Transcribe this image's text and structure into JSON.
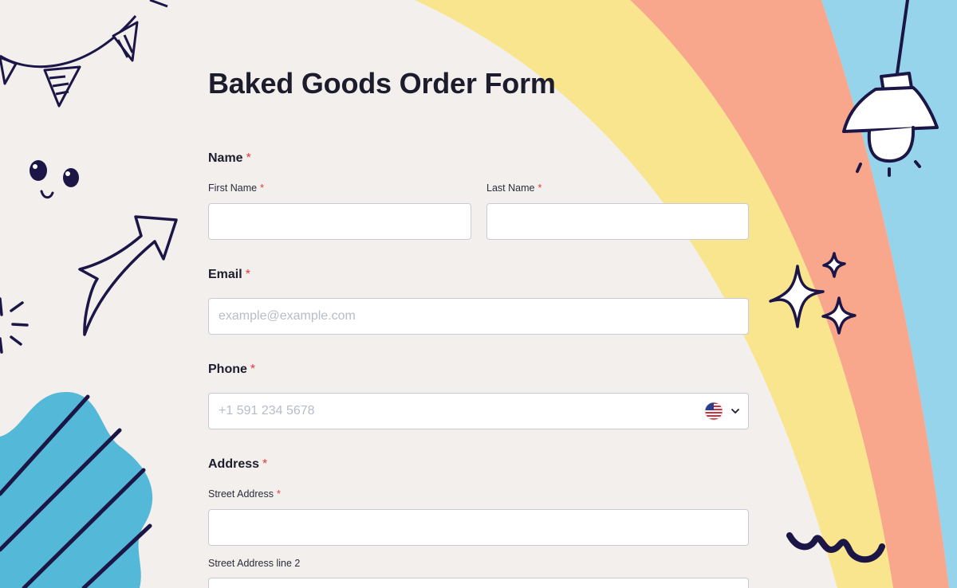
{
  "form": {
    "title": "Baked Goods Order Form",
    "required_mark": "*",
    "name": {
      "label": "Name",
      "first_label": "First Name",
      "first_value": "",
      "last_label": "Last Name",
      "last_value": ""
    },
    "email": {
      "label": "Email",
      "value": "",
      "placeholder": "example@example.com"
    },
    "phone": {
      "label": "Phone",
      "value": "",
      "placeholder": "+1 591 234 5678",
      "country_icon": "us-flag-icon"
    },
    "address": {
      "label": "Address",
      "street_label": "Street Address",
      "street_value": "",
      "street2_label": "Street Address line 2",
      "street2_value": ""
    }
  },
  "colors": {
    "background": "#f3efec",
    "stripe_yellow": "#f8e58e",
    "stripe_salmon": "#f8a78c",
    "stripe_blue": "#96d4ec",
    "blob_blue": "#54b9d9",
    "ink": "#1b1646",
    "required": "#e03a3a"
  }
}
